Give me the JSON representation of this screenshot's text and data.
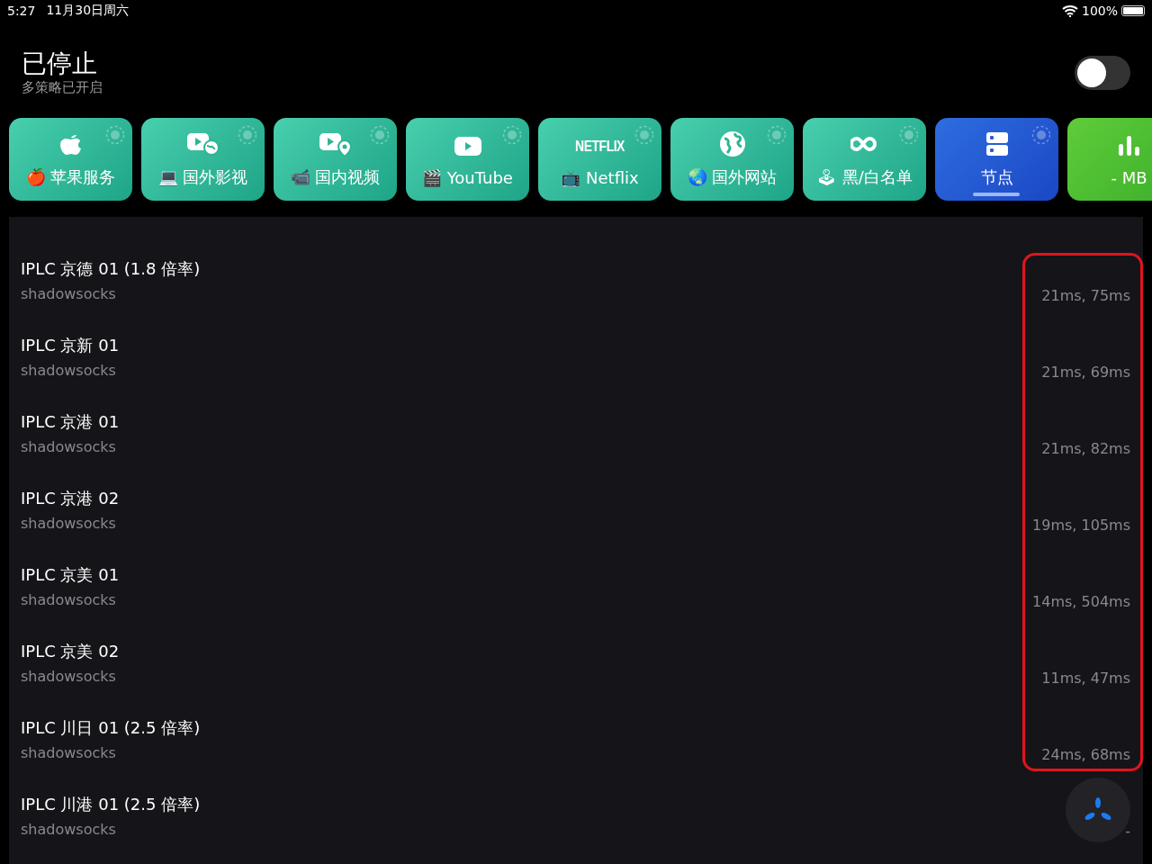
{
  "status_bar": {
    "time": "5:27",
    "date": "11月30日周六",
    "battery": "100%"
  },
  "header": {
    "title": "已停止",
    "subtitle": "多策略已开启",
    "switch_on": false
  },
  "tiles": [
    {
      "kind": "policy",
      "label": "🍎 苹果服务",
      "selected": false
    },
    {
      "kind": "policy",
      "label": "💻 国外影视",
      "selected": false
    },
    {
      "kind": "policy",
      "label": "📹 国内视频",
      "selected": false
    },
    {
      "kind": "policy",
      "label": "🎬 YouTube",
      "selected": false
    },
    {
      "kind": "policy",
      "logo_text": "NETFLIX",
      "label": "📺 Netflix",
      "selected": false
    },
    {
      "kind": "policy",
      "label": "🌏 国外网站",
      "selected": false
    },
    {
      "kind": "policy",
      "label": "🕹 黑/白名单",
      "selected": false
    },
    {
      "kind": "policy",
      "label": "节点",
      "selected": true
    },
    {
      "kind": "traffic",
      "label": "- MB",
      "selected": false
    }
  ],
  "nodes": [
    {
      "name": "IPLC 京德 01 (1.8 倍率)",
      "protocol": "shadowsocks",
      "latency": "21ms, 75ms"
    },
    {
      "name": "IPLC 京新 01",
      "protocol": "shadowsocks",
      "latency": "21ms, 69ms"
    },
    {
      "name": "IPLC 京港 01",
      "protocol": "shadowsocks",
      "latency": "21ms, 82ms"
    },
    {
      "name": "IPLC 京港 02",
      "protocol": "shadowsocks",
      "latency": "19ms, 105ms"
    },
    {
      "name": "IPLC 京美 01",
      "protocol": "shadowsocks",
      "latency": "14ms, 504ms"
    },
    {
      "name": "IPLC 京美 02",
      "protocol": "shadowsocks",
      "latency": "11ms, 47ms"
    },
    {
      "name": "IPLC 川日 01 (2.5 倍率)",
      "protocol": "shadowsocks",
      "latency": "24ms, 68ms"
    },
    {
      "name": "IPLC 川港 01 (2.5 倍率)",
      "protocol": "shadowsocks",
      "latency": "-"
    }
  ]
}
